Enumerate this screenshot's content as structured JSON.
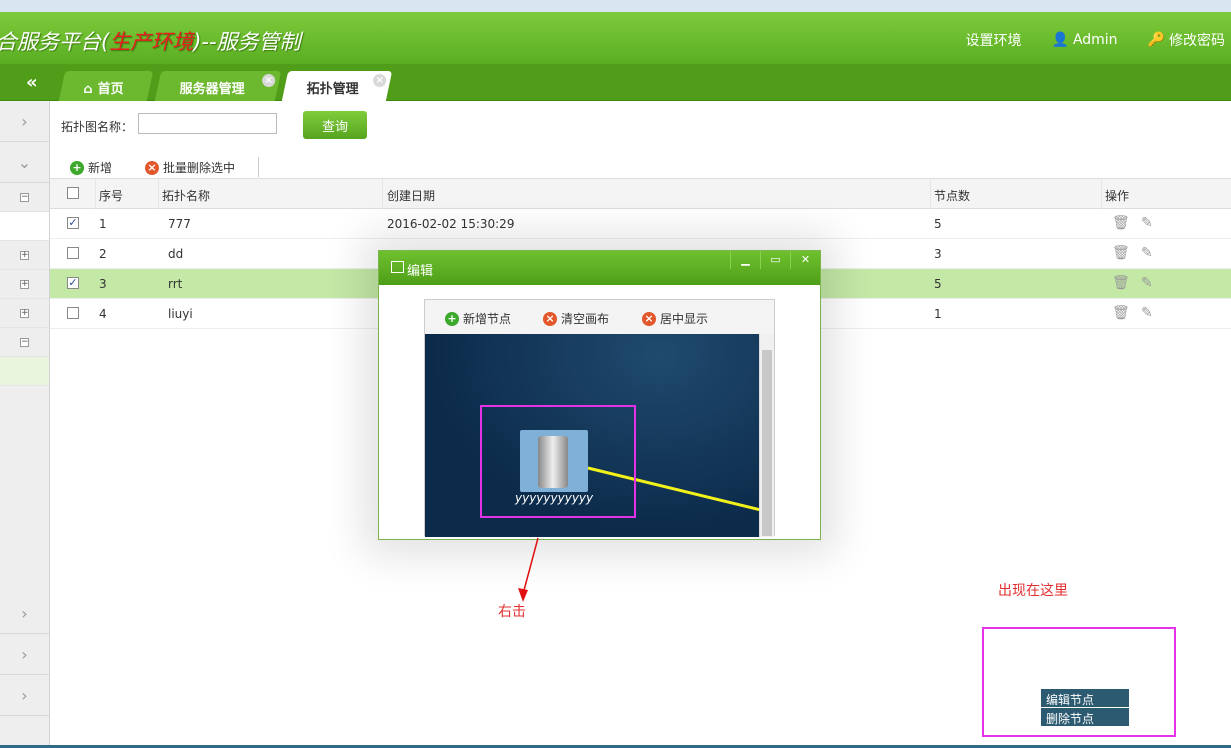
{
  "header": {
    "title_prefix": "合服务平台(",
    "title_env": "生产环境",
    "title_suffix": ")--服务管制",
    "set_env": "设置环境",
    "user": "Admin",
    "change_pwd": "修改密码"
  },
  "tabs": [
    {
      "label": "首页"
    },
    {
      "label": "服务器管理"
    },
    {
      "label": "拓扑管理"
    }
  ],
  "search": {
    "label": "拓扑图名称：",
    "value": "",
    "button": "查询"
  },
  "toolbar": {
    "add": "新增",
    "batch_delete": "批量删除选中"
  },
  "table": {
    "headers": [
      "序号",
      "拓扑名称",
      "创建日期",
      "节点数",
      "操作"
    ],
    "rows": [
      {
        "no": "1",
        "name": "777",
        "date": "2016-02-02 15:30:29",
        "nodes": "5",
        "checked": true
      },
      {
        "no": "2",
        "name": "dd",
        "date": "",
        "nodes": "3",
        "checked": false
      },
      {
        "no": "3",
        "name": "rrt",
        "date": "",
        "nodes": "5",
        "checked": true
      },
      {
        "no": "4",
        "name": "liuyi",
        "date": "",
        "nodes": "1",
        "checked": false
      }
    ]
  },
  "dialog": {
    "title": "编辑",
    "add_node": "新增节点",
    "clear_canvas": "清空画布",
    "center_display": "居中显示",
    "node_label": "yyyyyyyyyyy"
  },
  "annotations": {
    "right_click": "右击",
    "appears_here": "出现在这里"
  },
  "context_menu": [
    "编辑节点",
    "删除节点"
  ]
}
